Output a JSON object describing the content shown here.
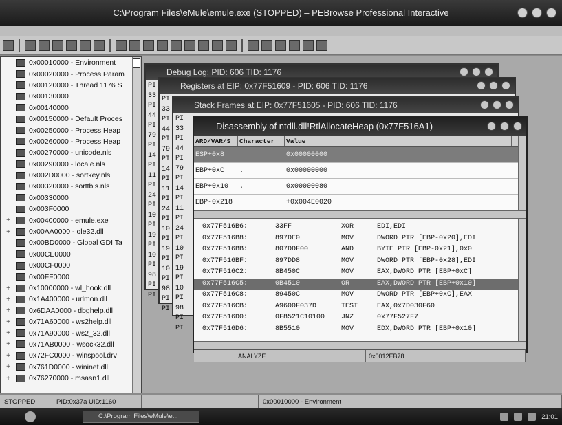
{
  "window": {
    "title": "C:\\Program Files\\eMule\\emule.exe (STOPPED) – PEBrowse Professional Interactive"
  },
  "tree": {
    "items": [
      {
        "exp": "",
        "label": "0x00010000 - Environment"
      },
      {
        "exp": "",
        "label": "0x00020000 - Process Param"
      },
      {
        "exp": "",
        "label": "0x00120000 - Thread 1176 S"
      },
      {
        "exp": "",
        "label": "0x00130000"
      },
      {
        "exp": "",
        "label": "0x00140000"
      },
      {
        "exp": "",
        "label": "0x00150000 - Default Proces"
      },
      {
        "exp": "",
        "label": "0x00250000 - Process Heap"
      },
      {
        "exp": "",
        "label": "0x00260000 - Process Heap"
      },
      {
        "exp": "",
        "label": "0x00270000 - unicode.nls"
      },
      {
        "exp": "",
        "label": "0x00290000 - locale.nls"
      },
      {
        "exp": "",
        "label": "0x002D0000 - sortkey.nls"
      },
      {
        "exp": "",
        "label": "0x00320000 - sorttbls.nls"
      },
      {
        "exp": "",
        "label": "0x00330000"
      },
      {
        "exp": "",
        "label": "0x003F0000"
      },
      {
        "exp": "+",
        "label": "0x00400000 - emule.exe"
      },
      {
        "exp": "+",
        "label": "0x00AA0000 - ole32.dll"
      },
      {
        "exp": "",
        "label": "0x00BD0000 - Global GDI Ta"
      },
      {
        "exp": "",
        "label": "0x00CE0000"
      },
      {
        "exp": "",
        "label": "0x00CF0000"
      },
      {
        "exp": "",
        "label": "0x00FF0000"
      },
      {
        "exp": "+",
        "label": "0x10000000 - wl_hook.dll"
      },
      {
        "exp": "+",
        "label": "0x1A400000 - urlmon.dll"
      },
      {
        "exp": "+",
        "label": "0x6DAA0000 - dbghelp.dll"
      },
      {
        "exp": "+",
        "label": "0x71A60000 - ws2help.dll"
      },
      {
        "exp": "+",
        "label": "0x71A90000 - ws2_32.dll"
      },
      {
        "exp": "+",
        "label": "0x71AB0000 - wsock32.dll"
      },
      {
        "exp": "+",
        "label": "0x72FC0000 - winspool.drv"
      },
      {
        "exp": "+",
        "label": "0x761D0000 - wininet.dll"
      },
      {
        "exp": "+",
        "label": "0x76270000 - msasn1.dll"
      }
    ]
  },
  "windows": {
    "debug_log": {
      "title": "Debug Log: PID: 606 TID: 1176"
    },
    "registers": {
      "title": "Registers at EIP: 0x77F51609 - PID: 606 TID: 1176"
    },
    "stack_frames": {
      "title": "Stack Frames at EIP: 0x77F51605 - PID: 606 TID: 1176"
    },
    "disassembly": {
      "title": "Disassembly of ntdll.dll!RtlAllocateHeap (0x77F516A1)",
      "columns": [
        "ARD/VAR/S",
        "Character",
        "Value"
      ],
      "rows": [
        {
          "a": "ESP+0x8",
          "b": "",
          "c": "0x00000000"
        },
        {
          "a": "EBP+0xC",
          "b": ".",
          "c": "0x00000000"
        },
        {
          "a": "EBP+0x10",
          "b": ".",
          "c": "0x00000080"
        },
        {
          "a": "EBP-0x218",
          "b": "",
          "c": "+0x004E0020"
        }
      ],
      "asm": [
        {
          "addr": "0x77F516B6:",
          "bytes": "33FF",
          "op": "XOR",
          "args": "EDI,EDI"
        },
        {
          "addr": "0x77F516B8:",
          "bytes": "897DE0",
          "op": "MOV",
          "args": "DWORD PTR [EBP-0x20],EDI"
        },
        {
          "addr": "0x77F516BB:",
          "bytes": "807DDF00",
          "op": "AND",
          "args": "BYTE PTR [EBP-0x21],0x0"
        },
        {
          "addr": "0x77F516BF:",
          "bytes": "897DD8",
          "op": "MOV",
          "args": "DWORD PTR [EBP-0x28],EDI"
        },
        {
          "addr": "0x77F516C2:",
          "bytes": "8B450C",
          "op": "MOV",
          "args": "EAX,DWORD PTR [EBP+0xC]"
        },
        {
          "addr": "0x77F516C5:",
          "bytes": "0B4510",
          "op": "OR",
          "args": "EAX,DWORD PTR [EBP+0x10]"
        },
        {
          "addr": "0x77F516C8:",
          "bytes": "89450C",
          "op": "MOV",
          "args": "DWORD PTR [EBP+0xC],EAX"
        },
        {
          "addr": "0x77F516CB:",
          "bytes": "A9600F037D",
          "op": "TEST",
          "args": "EAX,0x7D030F60"
        },
        {
          "addr": "0x77F516D0:",
          "bytes": "0F8521C10100",
          "op": "JNZ",
          "args": "0x77F527F7"
        },
        {
          "addr": "0x77F516D6:",
          "bytes": "8B5510",
          "op": "MOV",
          "args": "EDX,DWORD PTR [EBP+0x10]"
        }
      ],
      "status": [
        "ANALYZE",
        "0x0012EB78"
      ]
    },
    "stub_lines": [
      "PI",
      "33",
      "PI",
      "44",
      "PI",
      "79",
      "PI",
      "14",
      "PI",
      "11",
      "PI",
      "24",
      "PI",
      "10",
      "PI",
      "19",
      "PI",
      "10",
      "PI",
      "98",
      "PI",
      "PI"
    ]
  },
  "statusbar": {
    "state": "STOPPED",
    "pid": "PID:0x37a UID:1160",
    "address": "0x00010000 - Environment"
  },
  "taskbar": {
    "task": "C:\\Program Files\\eMule\\e...",
    "clock": "21:01"
  }
}
